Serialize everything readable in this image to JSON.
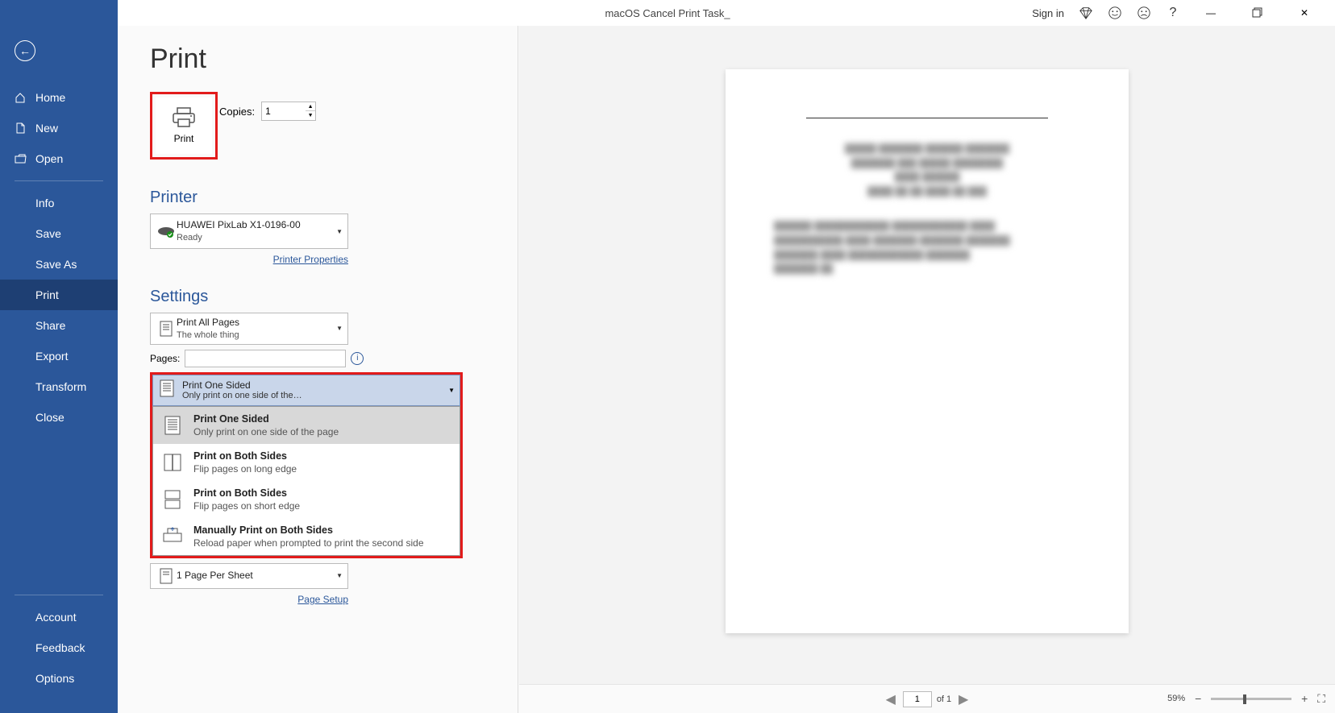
{
  "title_bar": {
    "document_title": "macOS Cancel Print Task_",
    "sign_in": "Sign in"
  },
  "sidebar": {
    "top": [
      {
        "label": "Home"
      },
      {
        "label": "New"
      },
      {
        "label": "Open"
      }
    ],
    "middle": [
      {
        "label": "Info"
      },
      {
        "label": "Save"
      },
      {
        "label": "Save As"
      },
      {
        "label": "Print",
        "selected": true
      },
      {
        "label": "Share"
      },
      {
        "label": "Export"
      },
      {
        "label": "Transform"
      },
      {
        "label": "Close"
      }
    ],
    "bottom": [
      {
        "label": "Account"
      },
      {
        "label": "Feedback"
      },
      {
        "label": "Options"
      }
    ]
  },
  "print": {
    "page_title": "Print",
    "button_label": "Print",
    "copies_label": "Copies:",
    "copies_value": "1",
    "printer_heading": "Printer",
    "printer_name": "HUAWEI PixLab X1-0196-00",
    "printer_status": "Ready",
    "printer_properties": "Printer Properties",
    "settings_heading": "Settings",
    "print_range": {
      "primary": "Print All Pages",
      "secondary": "The whole thing"
    },
    "pages_label": "Pages:",
    "pages_value": "",
    "sides_current": {
      "primary": "Print One Sided",
      "secondary": "Only print on one side of the…"
    },
    "sides_options": [
      {
        "title": "Print One Sided",
        "desc": "Only print on one side of the page",
        "selected": true
      },
      {
        "title": "Print on Both Sides",
        "desc": "Flip pages on long edge"
      },
      {
        "title": "Print on Both Sides",
        "desc": "Flip pages on short edge"
      },
      {
        "title": "Manually Print on Both Sides",
        "desc": "Reload paper when prompted to print the second side"
      }
    ],
    "per_sheet": {
      "primary": "1 Page Per Sheet"
    },
    "page_setup": "Page Setup"
  },
  "preview": {
    "current_page": "1",
    "total_pages": "of 1",
    "zoom_percent": "59%"
  }
}
